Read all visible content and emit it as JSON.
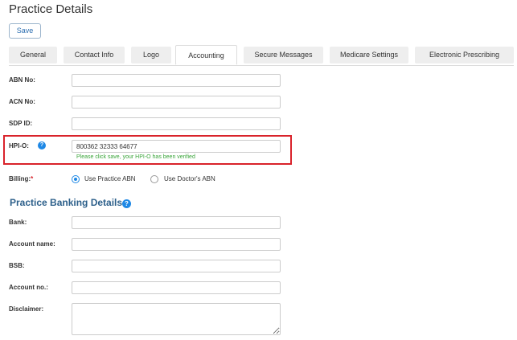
{
  "page": {
    "title": "Practice Details"
  },
  "toolbar": {
    "save_label": "Save"
  },
  "tabs": [
    {
      "label": "General"
    },
    {
      "label": "Contact Info"
    },
    {
      "label": "Logo"
    },
    {
      "label": "Accounting",
      "active": true
    },
    {
      "label": "Secure Messages"
    },
    {
      "label": "Medicare Settings"
    },
    {
      "label": "Electronic Prescribing"
    }
  ],
  "accounting": {
    "abn_label": "ABN No:",
    "abn_value": "",
    "acn_label": "ACN No:",
    "acn_value": "",
    "sdp_label": "SDP ID:",
    "sdp_value": "",
    "hpio_label": "HPI-O:",
    "hpio_value": "800362 32333 64677",
    "hpio_message": "Please click save, your HPI-O has been verified",
    "billing_label": "Billing:",
    "billing_required": "*",
    "billing_options": [
      {
        "label": "Use Practice ABN",
        "selected": true
      },
      {
        "label": "Use Doctor's ABN",
        "selected": false
      }
    ]
  },
  "banking": {
    "section_title": "Practice Banking Details",
    "bank_label": "Bank:",
    "bank_value": "",
    "account_name_label": "Account name:",
    "account_name_value": "",
    "bsb_label": "BSB:",
    "bsb_value": "",
    "account_no_label": "Account no.:",
    "account_no_value": "",
    "disclaimer_label": "Disclaimer:",
    "disclaimer_value": ""
  },
  "icons": {
    "help": "?"
  },
  "colors": {
    "accent": "#1e88e5",
    "highlight": "#d9232b",
    "success": "#3aa53a",
    "section_title": "#2c5f8a"
  }
}
